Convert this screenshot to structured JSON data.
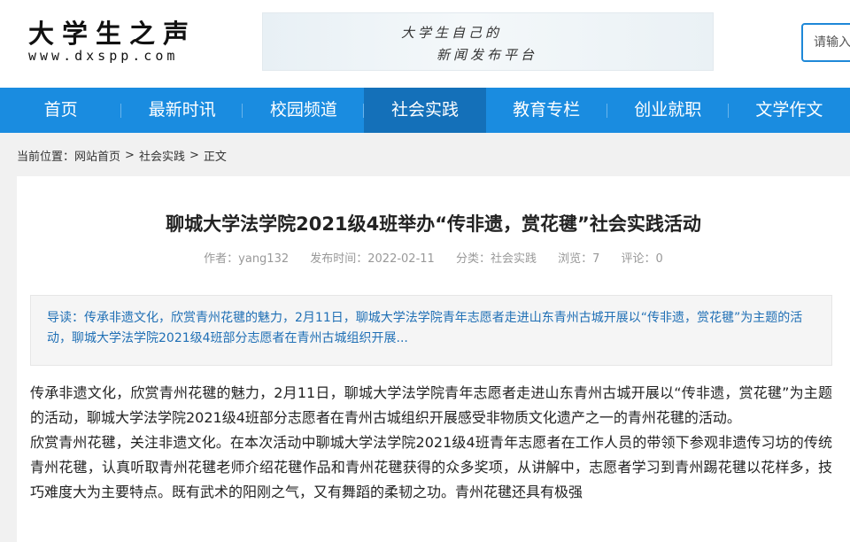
{
  "header": {
    "logo_main": "大学生之声",
    "logo_url": "www.dxspp.com",
    "banner_line1": "大学生自己的",
    "banner_line2": "新闻发布平台",
    "search_placeholder": "请输入"
  },
  "nav": {
    "items": [
      {
        "label": "首页"
      },
      {
        "label": "最新时讯"
      },
      {
        "label": "校园频道"
      },
      {
        "label": "社会实践"
      },
      {
        "label": "教育专栏"
      },
      {
        "label": "创业就职"
      },
      {
        "label": "文学作文"
      }
    ],
    "active": "社会实践"
  },
  "breadcrumb": {
    "prefix": "当前位置：",
    "home": "网站首页",
    "section": "社会实践",
    "current": "正文",
    "separator": ">"
  },
  "article": {
    "title": "聊城大学法学院2021级4班举办“传非遗，赏花毽”社会实践活动",
    "author": "作者：yang132",
    "date": "发布时间：2022-02-11",
    "category": "分类：社会实践",
    "views": "浏览：7",
    "comments": "评论：0",
    "summary": "导读：传承非遗文化，欣赏青州花毽的魅力，2月11日，聊城大学法学院青年志愿者走进山东青州古城开展以“传非遗，赏花毽”为主题的活动，聊城大学法学院2021级4班部分志愿者在青州古城组织开展...",
    "paragraph1": "传承非遗文化，欣赏青州花毽的魅力，2月11日，聊城大学法学院青年志愿者走进山东青州古城开展以“传非遗，赏花毽”为主题的活动，聊城大学法学院2021级4班部分志愿者在青州古城组织开展感受非物质文化遗产之一的青州花毽的活动。",
    "paragraph2": "欣赏青州花毽，关注非遗文化。在本次活动中聊城大学法学院2021级4班青年志愿者在工作人员的带领下参观非遗传习坊的传统青州花毽，认真听取青州花毽老师介绍花毽作品和青州花毽获得的众多奖项，从讲解中，志愿者学习到青州踢花毽以花样多，技巧难度大为主要特点。既有武术的阳刚之气，又有舞蹈的柔韧之功。青州花毽还具有极强"
  },
  "colors": {
    "nav_bg": "#1a8ce0",
    "nav_active": "#1470b9",
    "summary_text": "#1f6fb5",
    "page_bg": "#f1f1f1"
  }
}
